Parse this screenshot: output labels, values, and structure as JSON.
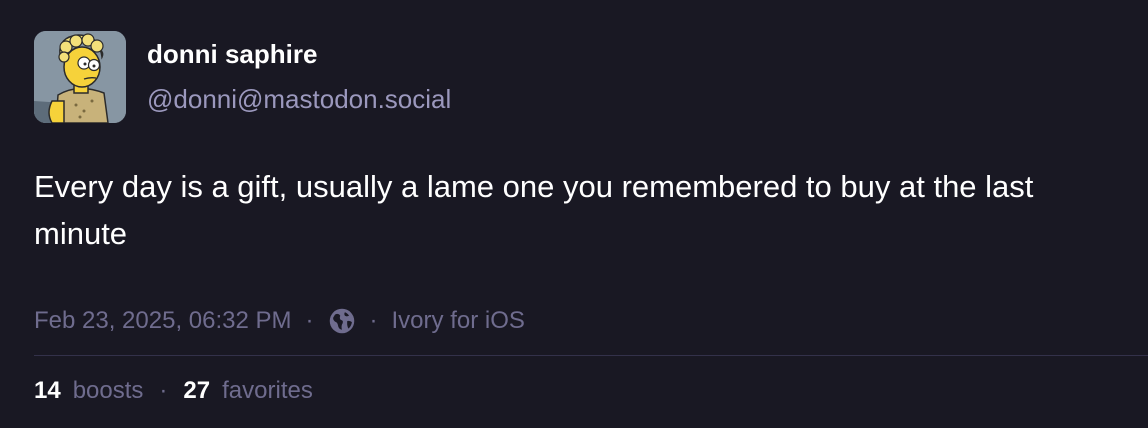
{
  "author": {
    "display_name": "donni saphire",
    "handle": "@donni@mastodon.social",
    "avatar_icon": "cartoon-character-avatar"
  },
  "post": {
    "text": "Every day is a gift, usually a lame one you remembered to buy at the last minute"
  },
  "meta": {
    "timestamp": "Feb 23, 2025, 06:32 PM",
    "separator": "·",
    "visibility_icon": "globe-icon",
    "application": "Ivory for iOS"
  },
  "stats": {
    "boosts_count": "14",
    "boosts_label": "boosts",
    "favorites_count": "27",
    "favorites_label": "favorites",
    "separator": "·"
  },
  "colors": {
    "background": "#191823",
    "primary_text": "#ffffff",
    "handle_text": "#9b98bd",
    "muted_text": "#6f6c8e",
    "divider": "#33314a"
  }
}
